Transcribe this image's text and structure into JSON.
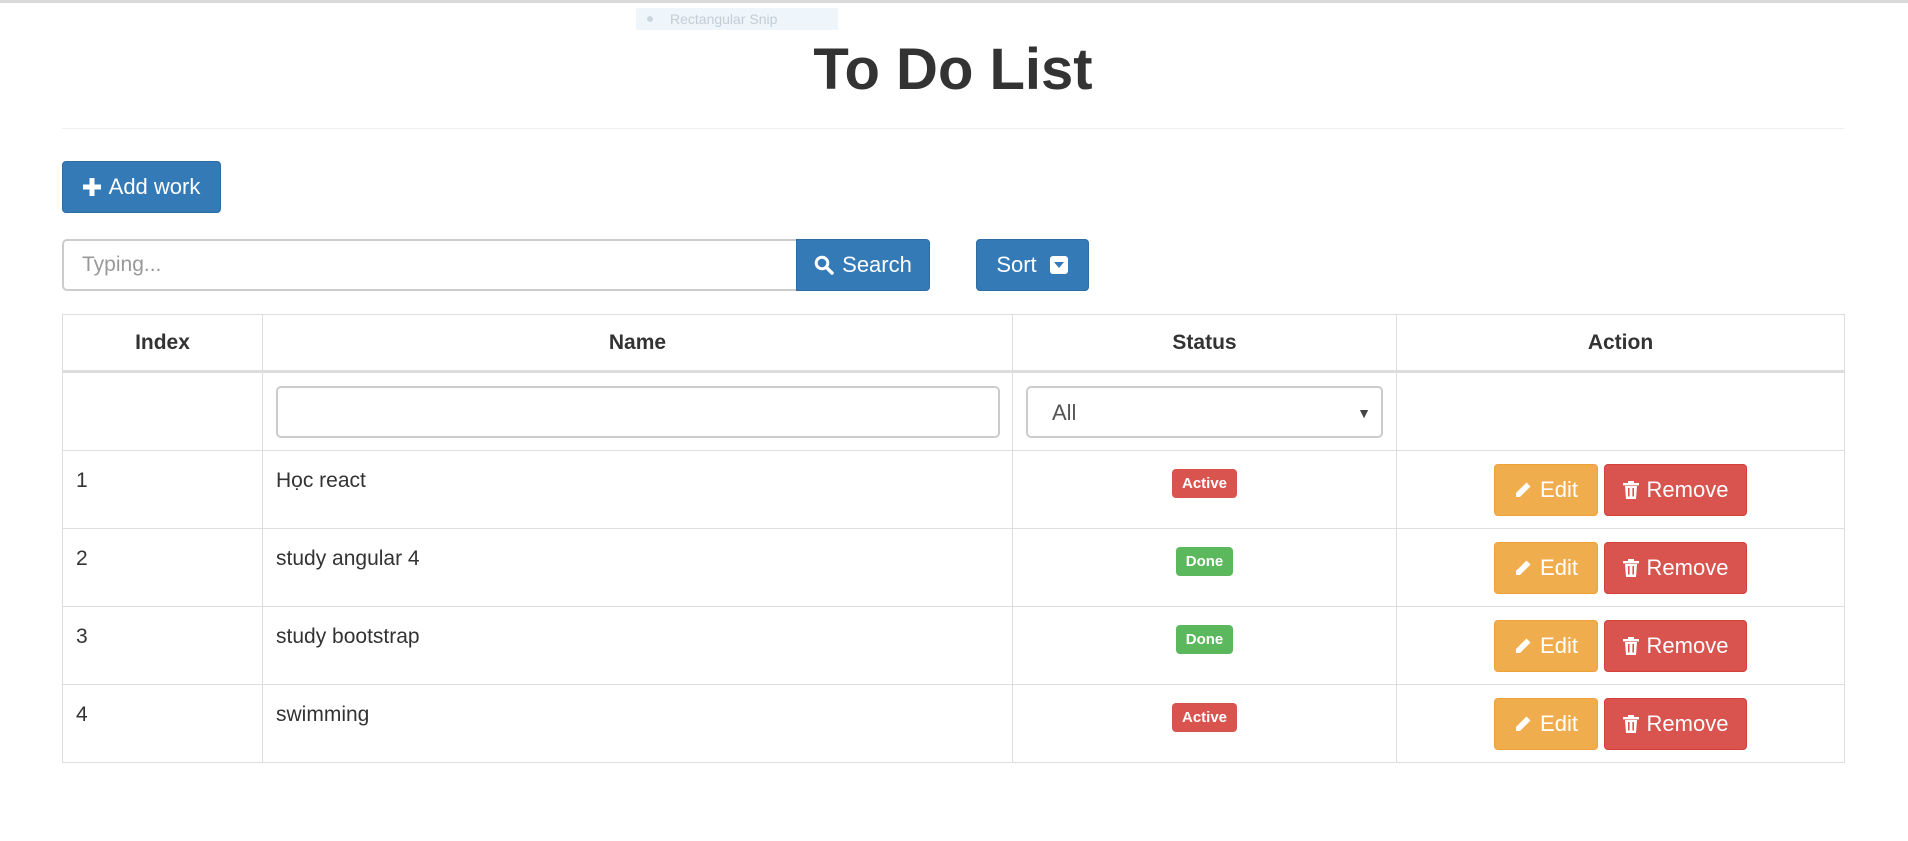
{
  "overlay": {
    "snip_label": "Rectangular Snip"
  },
  "page": {
    "title": "To Do List"
  },
  "toolbar": {
    "add_label": "Add work",
    "search_placeholder": "Typing...",
    "search_label": "Search",
    "sort_label": "Sort"
  },
  "table": {
    "headers": [
      "Index",
      "Name",
      "Status",
      "Action"
    ],
    "filter": {
      "name_value": "",
      "status_selected": "All"
    },
    "rows": [
      {
        "index": "1",
        "name": "Học react",
        "status": "Active",
        "status_type": "danger",
        "edit": "Edit",
        "remove": "Remove"
      },
      {
        "index": "2",
        "name": "study angular 4",
        "status": "Done",
        "status_type": "success",
        "edit": "Edit",
        "remove": "Remove"
      },
      {
        "index": "3",
        "name": "study bootstrap",
        "status": "Done",
        "status_type": "success",
        "edit": "Edit",
        "remove": "Remove"
      },
      {
        "index": "4",
        "name": "swimming",
        "status": "Active",
        "status_type": "danger",
        "edit": "Edit",
        "remove": "Remove"
      }
    ]
  },
  "colors": {
    "primary": "#337ab7",
    "warning": "#f0ad4e",
    "danger": "#d9534f",
    "success": "#5cb85c"
  }
}
